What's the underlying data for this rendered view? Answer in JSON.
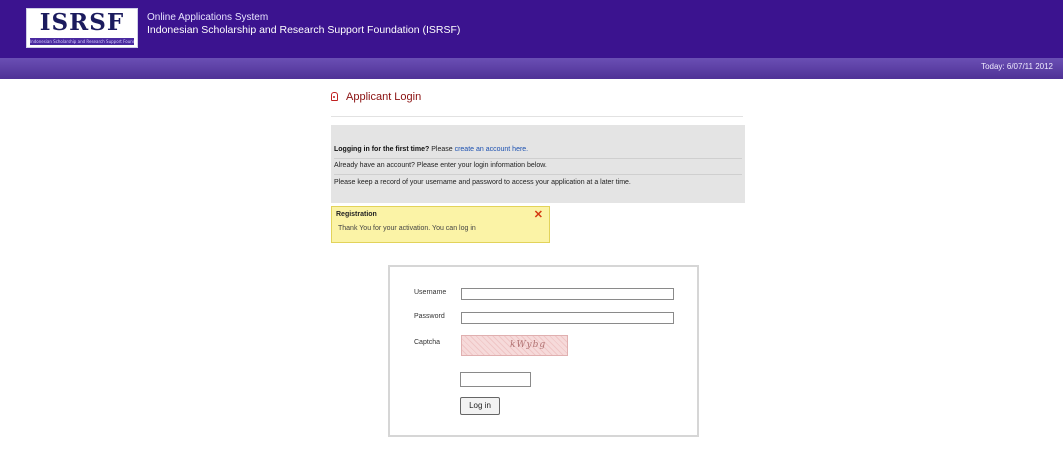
{
  "header": {
    "logo_text": "ISRSF",
    "logo_tagline": "Indonesian Scholarship and Research Support Foundation",
    "system_name": "Online Applications System",
    "org_name": "Indonesian Scholarship and Research Support Foundation (ISRSF)",
    "today": "Today: 6/07/11 2012"
  },
  "login": {
    "title": "Applicant Login",
    "info": {
      "first_time_bold": "Logging in for the first time?",
      "first_time_text": " Please ",
      "create_link": "create an account here.",
      "existing": "Already have an account? Please enter your login information below.",
      "keep_record": "Please keep a record of your username and password to access your application at a later time."
    },
    "notice": {
      "title": "Registration",
      "message": "Thank You for your activation. You can log in"
    },
    "form": {
      "username_label": "Username",
      "password_label": "Password",
      "captcha_label": "Captcha",
      "captcha_text": "kWybg",
      "username_value": "",
      "password_value": "",
      "captcha_value": "",
      "button_label": "Log in"
    }
  },
  "colors": {
    "header_bg": "#3b138f",
    "subbar_bg": "#5a3ca5",
    "title_red": "#8a1010",
    "link_blue": "#1a4fb0",
    "notice_bg": "#fbf3a6"
  }
}
